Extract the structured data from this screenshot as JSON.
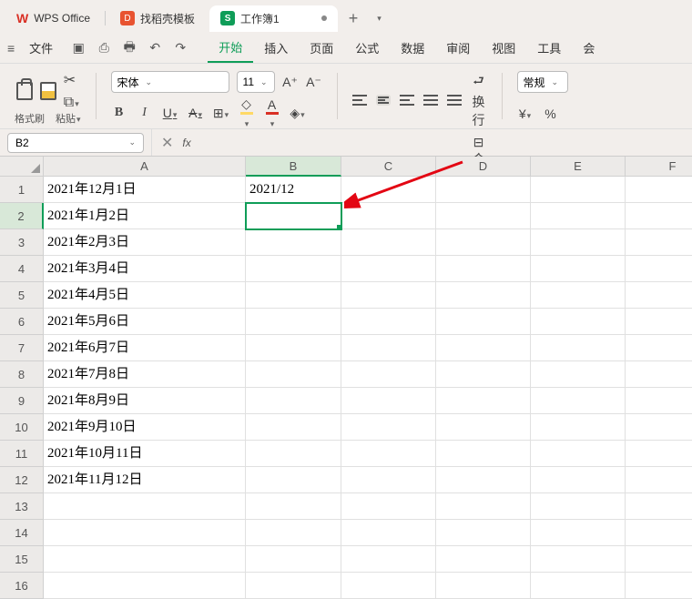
{
  "tabs": {
    "app": "WPS Office",
    "template": "找稻壳模板",
    "workbook": "工作簿1"
  },
  "qat": {
    "file": "文件"
  },
  "menu": {
    "items": [
      "开始",
      "插入",
      "页面",
      "公式",
      "数据",
      "审阅",
      "视图",
      "工具",
      "会"
    ],
    "active": 0
  },
  "ribbon": {
    "format_painter": "格式刷",
    "paste": "粘贴",
    "font_name": "宋体",
    "font_size": "11",
    "wrap": "换行",
    "merge": "合并",
    "general": "常规"
  },
  "namebox": "B2",
  "columns": [
    "A",
    "B",
    "C",
    "D",
    "E",
    "F"
  ],
  "rows_count": 16,
  "selected": {
    "row": 2,
    "col": "B"
  },
  "cells": {
    "A": [
      "2021年12月1日",
      "2021年1月2日",
      "2021年2月3日",
      "2021年3月4日",
      "2021年4月5日",
      "2021年5月6日",
      "2021年6月7日",
      "2021年7月8日",
      "2021年8月9日",
      "2021年9月10日",
      "2021年10月11日",
      "2021年11月12日",
      "",
      "",
      "",
      ""
    ],
    "B": [
      "2021/12",
      "",
      "",
      "",
      "",
      "",
      "",
      "",
      "",
      "",
      "",
      "",
      "",
      "",
      "",
      ""
    ]
  }
}
